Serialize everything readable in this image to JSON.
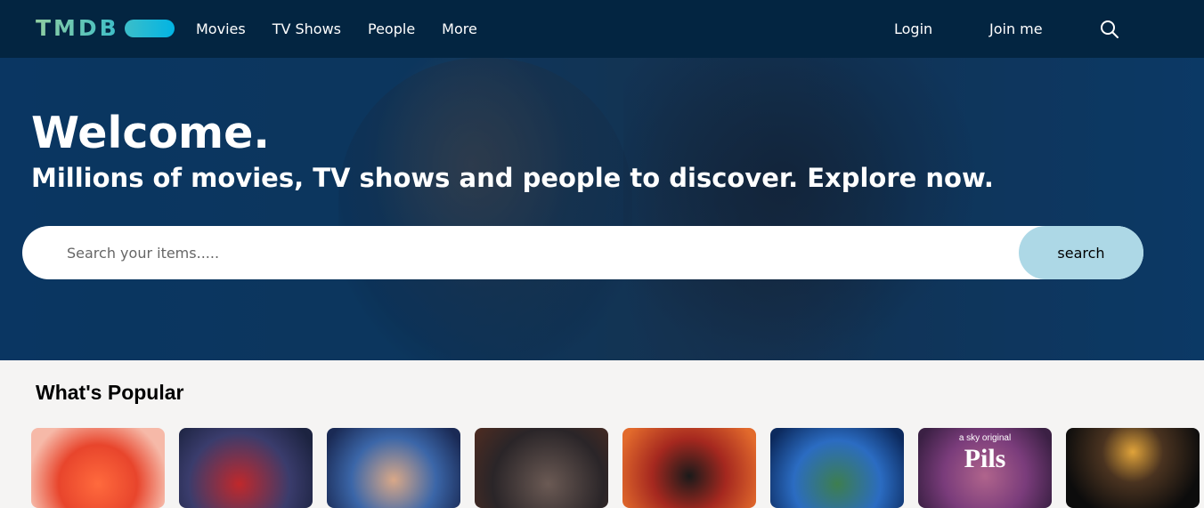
{
  "header": {
    "logo_text": "TMDB",
    "nav": [
      "Movies",
      "TV Shows",
      "People",
      "More"
    ],
    "login": "Login",
    "join": "Join me",
    "search_icon": "search-icon"
  },
  "hero": {
    "title": "Welcome.",
    "subtitle": "Millions of movies, TV shows and people to discover. Explore now.",
    "search_placeholder": "Search your items.....",
    "search_button": "search"
  },
  "popular": {
    "title": "What's Popular",
    "posters": [
      {
        "caption": "",
        "logo": ""
      },
      {
        "caption": "",
        "logo": ""
      },
      {
        "caption": "",
        "logo": ""
      },
      {
        "caption": "",
        "logo": ""
      },
      {
        "caption": "",
        "logo": ""
      },
      {
        "caption": "",
        "logo": ""
      },
      {
        "caption": "a sky original",
        "logo": "Pils"
      },
      {
        "caption": "",
        "logo": ""
      }
    ]
  },
  "colors": {
    "header_bg": "#032541",
    "logo_accent": "#90cea1",
    "search_button_bg": "#add8e6"
  }
}
